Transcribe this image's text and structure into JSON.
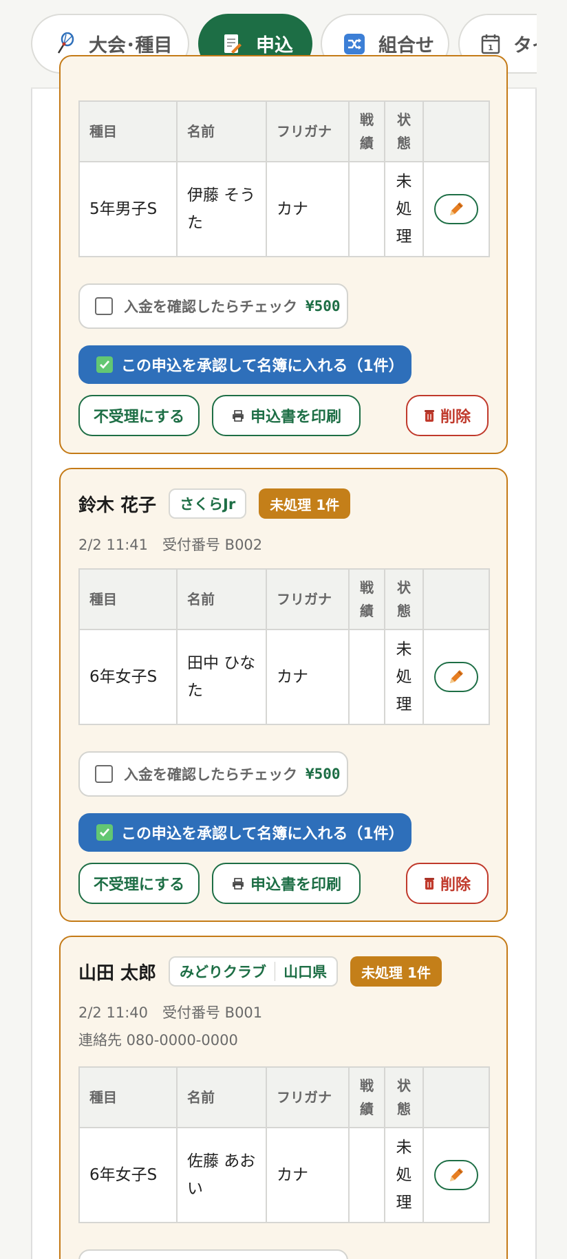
{
  "tabs": [
    {
      "label": "大会･種目",
      "icon": "shuttlecock-icon"
    },
    {
      "label": "申込",
      "icon": "memo-icon",
      "active": true
    },
    {
      "label": "組合せ",
      "icon": "shuffle-icon"
    },
    {
      "label": "タイムテーブル",
      "icon": "calendar-icon"
    }
  ],
  "table_headers": {
    "event": "種目",
    "name": "名前",
    "furigana": "フリガナ",
    "record": "戦績",
    "status": "状態"
  },
  "labels": {
    "payment_check": "入金を確認したらチェック",
    "reject": "不受理にする",
    "print": "申込書を印刷",
    "delete": "削除"
  },
  "colors": {
    "primary": "#1d6e45",
    "approve": "#2e6fba",
    "warning": "#c47f19",
    "danger": "#c0392b",
    "card_bg": "#fbf5ea"
  },
  "applications": [
    {
      "entry": {
        "event": "5年男子S",
        "name": "伊藤 そうた",
        "furigana": "カナ",
        "record": "",
        "status": "未処理"
      },
      "fee": "¥500",
      "approve_label": "この申込を承認して名簿に入れる（1件）"
    },
    {
      "applicant": "鈴木 花子",
      "club": "さくらJr",
      "badge": "未処理 1件",
      "received": "2/2 11:41　受付番号 B002",
      "entry": {
        "event": "6年女子S",
        "name": "田中 ひなた",
        "furigana": "カナ",
        "record": "",
        "status": "未処理"
      },
      "fee": "¥500",
      "approve_label": "この申込を承認して名簿に入れる（1件）"
    },
    {
      "applicant": "山田 太郎",
      "club": "みどりクラブ",
      "prefecture": "山口県",
      "badge": "未処理 1件",
      "received": "2/2 11:40　受付番号 B001",
      "contact": "連絡先 080-0000-0000",
      "entry": {
        "event": "6年女子S",
        "name": "佐藤 あおい",
        "furigana": "カナ",
        "record": "",
        "status": "未処理"
      }
    }
  ]
}
